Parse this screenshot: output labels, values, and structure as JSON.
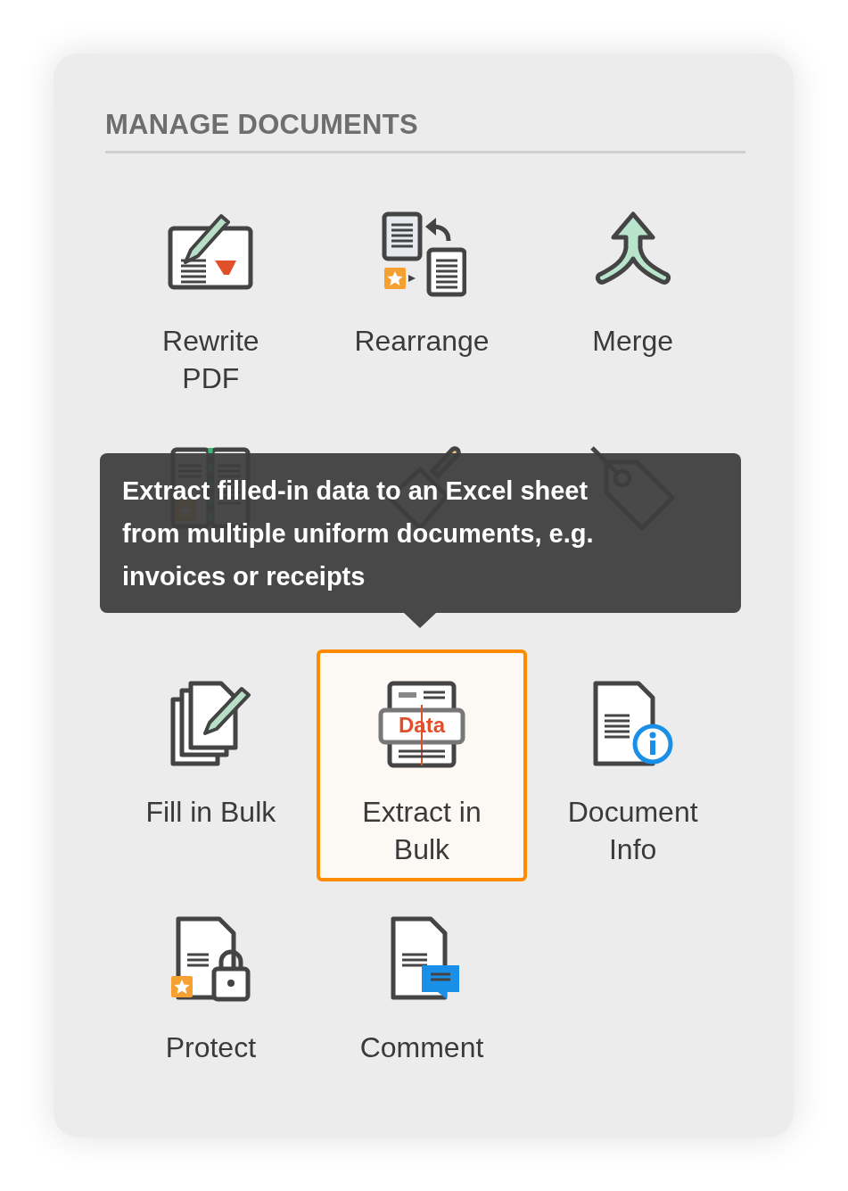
{
  "panel": {
    "title": "MANAGE DOCUMENTS",
    "tools": [
      {
        "kind": "rewrite",
        "label": "Rewrite PDF",
        "selected": false
      },
      {
        "kind": "rearrange",
        "label": "Rearrange",
        "selected": false
      },
      {
        "kind": "merge",
        "label": "Merge",
        "selected": false
      },
      {
        "kind": "split",
        "selected": false
      },
      {
        "kind": "clear",
        "selected": false
      },
      {
        "kind": "tag",
        "selected": false
      },
      {
        "kind": "fill",
        "label": "Fill in Bulk",
        "selected": false
      },
      {
        "kind": "extract",
        "label": "Extract in Bulk",
        "selected": true,
        "icon_text": "Data"
      },
      {
        "kind": "info",
        "label": "Document Info",
        "selected": false
      },
      {
        "kind": "protect",
        "label": "Protect",
        "selected": false
      },
      {
        "kind": "comment",
        "label": "Comment",
        "selected": false
      }
    ],
    "tooltip": "Extract filled-in data to an Excel sheet from multiple uniform documents, e.g. invoices or receipts"
  }
}
